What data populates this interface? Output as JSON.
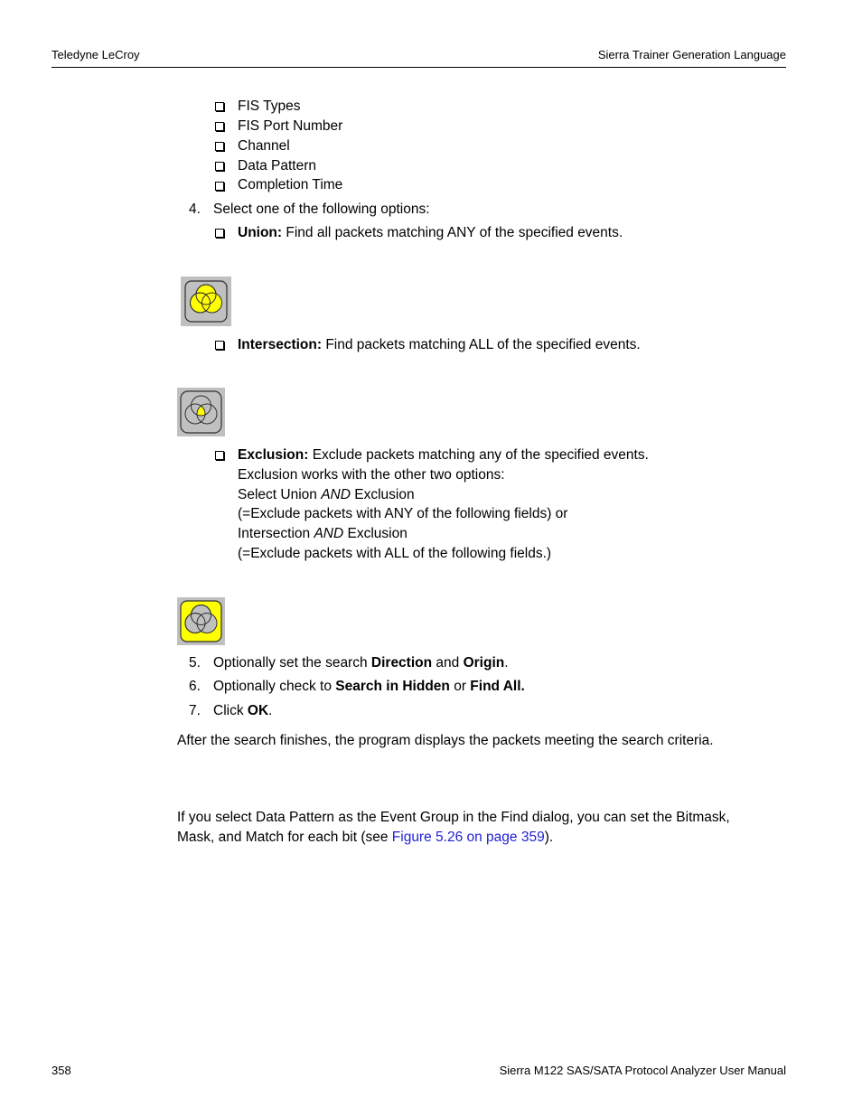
{
  "header": {
    "left": "Teledyne LeCroy",
    "right": "Sierra Trainer Generation Language"
  },
  "footer": {
    "page_number": "358",
    "manual_title": "Sierra M122 SAS/SATA Protocol Analyzer User Manual"
  },
  "event_fields": [
    "FIS Types",
    "FIS Port Number",
    "Channel",
    "Data Pattern",
    "Completion Time"
  ],
  "step4": {
    "number": "4.",
    "text": "Select one of the following options:"
  },
  "options": {
    "union": {
      "label": "Union:",
      "text": " Find all packets matching ANY of the specified events.",
      "icon": "venn-union-icon",
      "highlight_color": "#ffff00"
    },
    "intersection": {
      "label": "Intersection:",
      "text": " Find packets matching ALL of the specified events.",
      "icon": "venn-intersection-icon",
      "highlight_color": "#ffff00"
    },
    "exclusion": {
      "label": "Exclusion:",
      "text": " Exclude packets matching any of the specified events.",
      "line2": "Exclusion works with the other two options:",
      "line3_pre": "Select Union ",
      "line3_em": "AND",
      "line3_post": " Exclusion",
      "line4": "(=Exclude packets with ANY of the following fields) or",
      "line5_pre": "Intersection ",
      "line5_em": "AND",
      "line5_post": " Exclusion",
      "line6": "(=Exclude packets with ALL of the following fields.)",
      "icon": "venn-exclusion-icon",
      "highlight_color": "#ffff00"
    }
  },
  "steps": [
    {
      "number": "5.",
      "pre": "Optionally set the search ",
      "b1": "Direction",
      "mid": " and ",
      "b2": "Origin",
      "post": "."
    },
    {
      "number": "6.",
      "pre": "Optionally check to ",
      "b1": "Search in Hidden",
      "mid": " or ",
      "b2": "Find All.",
      "post": ""
    },
    {
      "number": "7.",
      "pre": "Click ",
      "b1": "OK",
      "post": "."
    }
  ],
  "after_search": "After the search finishes, the program displays the packets meeting the search criteria.",
  "data_pattern_para": {
    "line1": "If you select Data Pattern as the Event Group in the Find dialog, you can set the Bitmask,",
    "line2_pre": "Mask, and Match for each bit (see ",
    "link": "Figure 5.26 on page 359",
    "line2_post": ")."
  }
}
